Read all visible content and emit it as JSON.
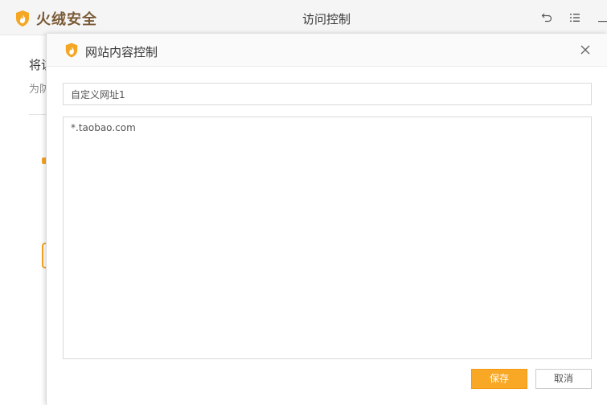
{
  "app": {
    "name": "火绒安全",
    "window_title": "访问控制",
    "logo_icon": "huorong-shield-flame-icon",
    "toolbar_icons": [
      "back-icon",
      "menu-icon",
      "minimize-icon"
    ]
  },
  "background": {
    "heading": "将访",
    "description": "为防"
  },
  "dialog": {
    "title": "网站内容控制",
    "name_field_value": "自定义网址1",
    "urls_value": "*.taobao.com",
    "save_label": "保存",
    "cancel_label": "取消"
  },
  "colors": {
    "accent": "#f9a826",
    "brand_text": "#7a5a36",
    "titlebar_bg": "#f5f5f5"
  }
}
